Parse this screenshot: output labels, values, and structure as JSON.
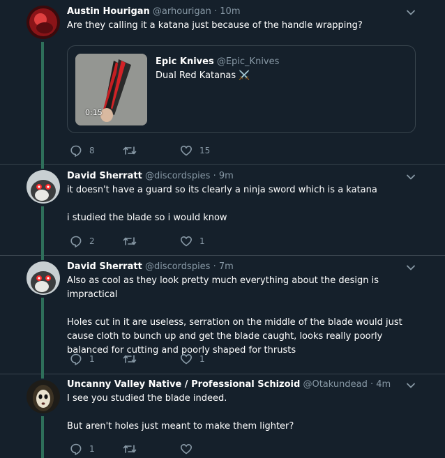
{
  "colors": {
    "background": "#15202b",
    "border": "#38444d",
    "secondary_text": "#8899a6",
    "thread_line": "#2e6f5a",
    "primary_text": "#ffffff"
  },
  "tweets": [
    {
      "name": "Austin Hourigan",
      "handle": "@arhourigan",
      "separator": "·",
      "time": "10m",
      "text": [
        "Are they calling it a katana just because of the handle wrapping?"
      ],
      "quoted": {
        "name": "Epic Knives",
        "handle": "@Epic_Knives",
        "text": "Dual Red Katanas ⚔️",
        "duration": "0:15"
      },
      "reply_count": "8",
      "retweet_count": "",
      "like_count": "15"
    },
    {
      "name": "David Sherratt",
      "handle": "@discordspies",
      "separator": "·",
      "time": "9m",
      "text": [
        "it doesn't have a guard so its clearly a ninja sword which is a katana",
        "i studied the blade so i would know"
      ],
      "reply_count": "2",
      "retweet_count": "",
      "like_count": "1"
    },
    {
      "name": "David Sherratt",
      "handle": "@discordspies",
      "separator": "·",
      "time": "7m",
      "text": [
        "Also as cool as they look pretty much everything about the design is impractical",
        "Holes cut in it are useless, serration on the middle of the blade would just cause cloth to bunch up and get the blade caught, looks really poorly balanced for cutting and poorly shaped for thrusts"
      ],
      "reply_count": "1",
      "retweet_count": "",
      "like_count": "1"
    },
    {
      "name": "Uncanny Valley Native / Professional Schizoid",
      "handle": "@Otakundead",
      "separator": "·",
      "time": "4m",
      "text": [
        "I see you studied the blade indeed.",
        "But aren't holes just meant to make them lighter?"
      ],
      "reply_count": "1",
      "retweet_count": "",
      "like_count": ""
    }
  ],
  "icons": {
    "reply": "reply-icon",
    "retweet": "retweet-icon",
    "like": "heart-icon",
    "more": "chevron-down-icon"
  }
}
